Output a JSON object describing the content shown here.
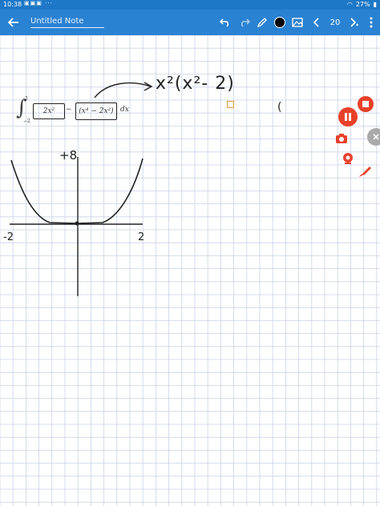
{
  "status": {
    "time": "10:38",
    "battery": "27%"
  },
  "toolbar": {
    "title": "Untitled Note",
    "page_number": "20",
    "current_color": "#000000",
    "icons": [
      "back-arrow-icon",
      "undo-icon",
      "redo-icon",
      "pen-icon",
      "color-dot",
      "image-icon",
      "chevron-left-icon",
      "chevron-right-icon",
      "more-icon"
    ]
  },
  "note": {
    "formula": {
      "upper": "2",
      "lower": "−2",
      "term1": "2x²",
      "minus": "−",
      "term2": "(x⁴ − 2x²)",
      "dx": "dx"
    },
    "handwriting": {
      "expression": "x²(x²- 2)",
      "stray_mark": "(",
      "y_label": "+8",
      "x_left": "-2",
      "x_right": "2"
    }
  },
  "colors": {
    "statusbar": "#1e78c8",
    "toolbar": "#2a82d2",
    "grid": "#c9d3e6",
    "record": "#e8412a"
  }
}
